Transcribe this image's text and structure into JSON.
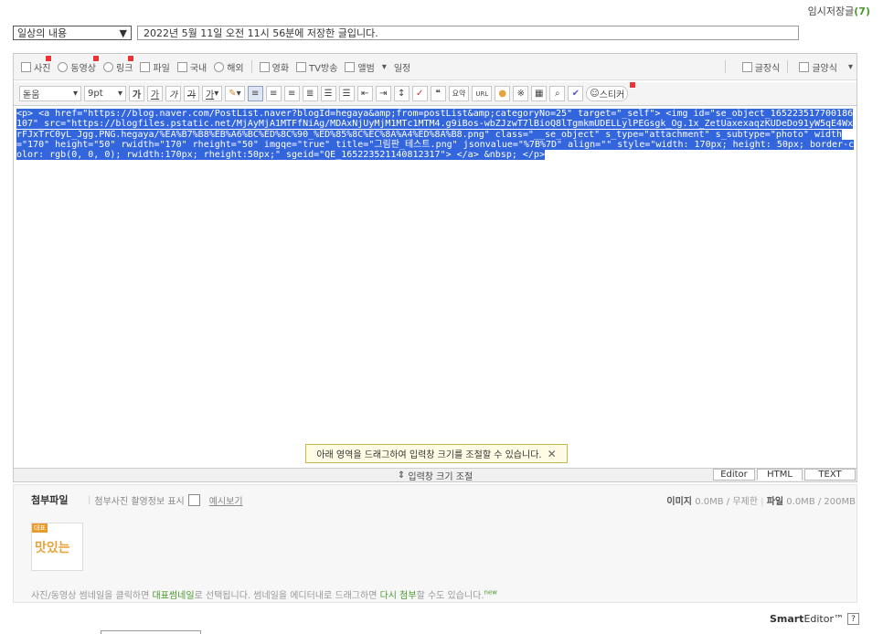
{
  "header": {
    "drafts_label": "임시저장글",
    "drafts_count": "(7)"
  },
  "category": {
    "selected": "일상의 내용"
  },
  "title": {
    "value": "2022년 5월 11일 오전 11시 56분에 저장한 글입니다."
  },
  "toolbar1": {
    "items": [
      "사진",
      "동영상",
      "링크",
      "파일",
      "국내",
      "해외",
      "영화",
      "TV방송",
      "앨범",
      "일정"
    ],
    "right_items": [
      "글장식",
      "글양식"
    ]
  },
  "toolbar2": {
    "font": "돋움",
    "size": "9pt",
    "buttons": [
      "가",
      "가",
      "가",
      "가",
      "가"
    ],
    "sticker": "스티커",
    "summary": "요약",
    "url": "URL"
  },
  "editor": {
    "html_source": "<p> <a href=\"https://blog.naver.com/PostList.naver?blogId=hegaya&amp;from=postList&amp;categoryNo=25\" target=\"_self\"> <img id=\"se_object_165223517700186107\" src=\"https://blogfiles.pstatic.net/MjAyMjA1MTFfNiAg/MDAxNjUyMjM1MTc1MTM4.g9iBos-wbZJzwT7lBioQ8lTgmkmUDELLylPEGsgk_Og.1x_ZetUaxexaqzKUDeDo91yW5qE4WxrFJxTrC0yL_Jgg.PNG.hegaya/%EA%B7%B8%EB%A6%BC%ED%8C%90_%ED%85%8C%EC%8A%A4%ED%8A%B8.png\" class=\"__se_object\" s_type=\"attachment\" s_subtype=\"photo\" width=\"170\" height=\"50\" rwidth=\"170\" rheight=\"50\" imgqe=\"true\" title=\"그림판_테스트.png\" jsonvalue=\"%7B%7D\" align=\"\" style=\"width: 170px; height: 50px; border-color: rgb(0, 0, 0); rwidth:170px; rheight:50px;\" sgeid=\"QE_165223521140812317\"> </a> &nbsp; </p>"
  },
  "tooltip": {
    "text": "아래 영역을 드래그하여 입력창 크기를 조절할 수 있습니다."
  },
  "resize": {
    "label": "입력창 크기 조절"
  },
  "modes": {
    "editor": "Editor",
    "html": "HTML",
    "text": "TEXT"
  },
  "attach": {
    "title": "첨부파일",
    "show_info": "첨부사진 촬영정보 표시",
    "example": "예시보기",
    "image_label": "이미지",
    "image_size": "0.0MB",
    "image_limit": "무제한",
    "file_label": "파일",
    "file_size": "0.0MB",
    "file_limit": "200MB",
    "thumb_tag": "대표",
    "thumb_text": "맛있는",
    "hint_pre": "사진/동영상 썸네일을 클릭하면 ",
    "hint_rep": "대표썸네일",
    "hint_mid": "로 선택됩니다. 썸네일을 에디터내로 드래그하면 ",
    "hint_att": "다시 첨부",
    "hint_post": "할 수도 있습니다.",
    "hint_new": "new"
  },
  "footer": {
    "brand_bold": "Smart",
    "brand_rest": "Editor™",
    "help": "?"
  }
}
